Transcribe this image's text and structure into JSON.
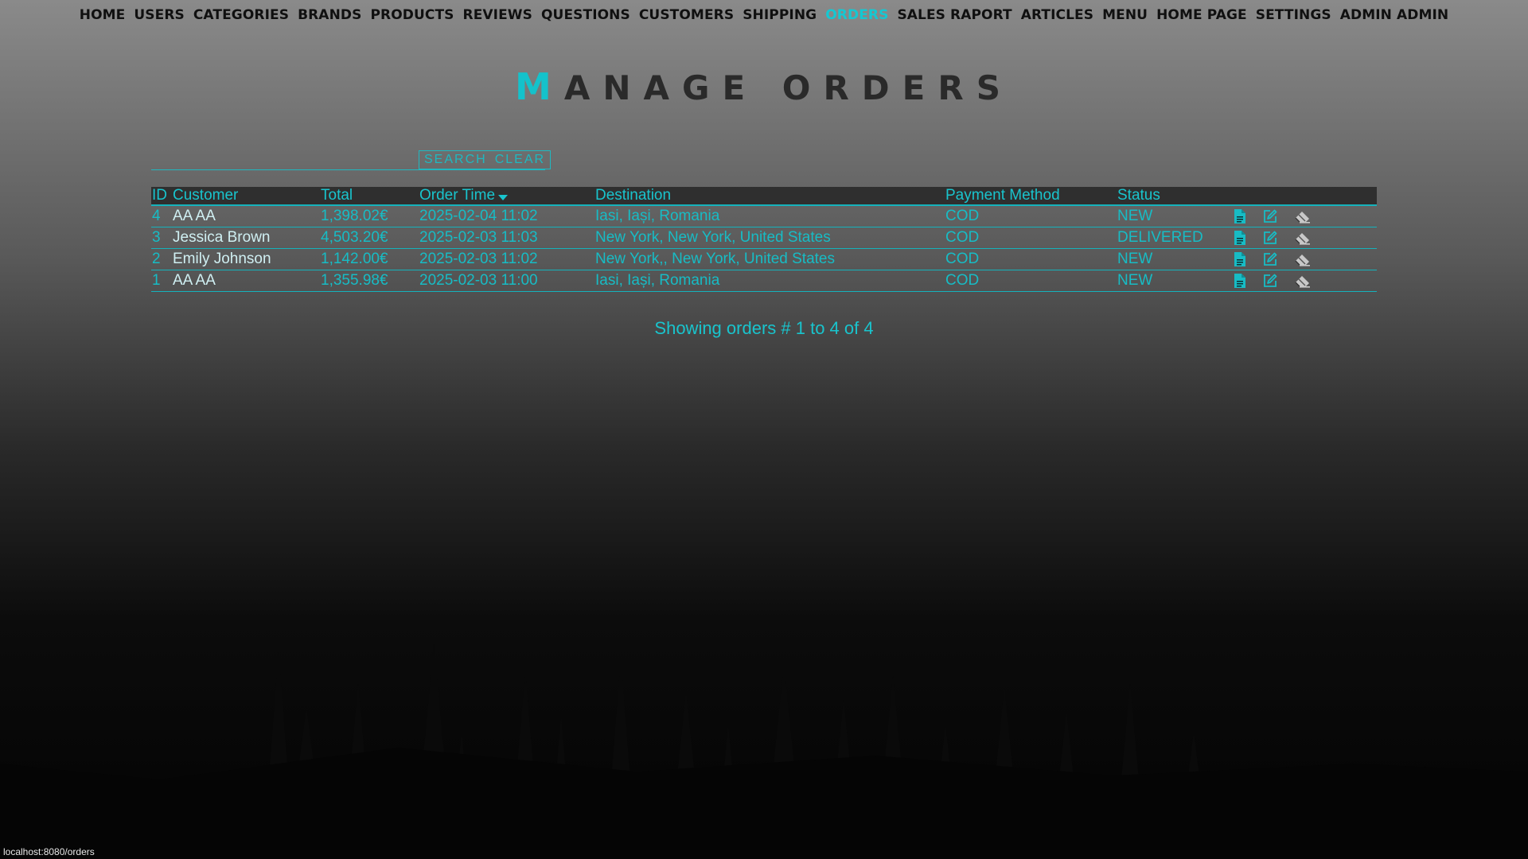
{
  "nav": {
    "items": [
      {
        "label": "HOME",
        "active": false
      },
      {
        "label": "USERS",
        "active": false
      },
      {
        "label": "CATEGORIES",
        "active": false
      },
      {
        "label": "BRANDS",
        "active": false
      },
      {
        "label": "PRODUCTS",
        "active": false
      },
      {
        "label": "REVIEWS",
        "active": false
      },
      {
        "label": "QUESTIONS",
        "active": false
      },
      {
        "label": "CUSTOMERS",
        "active": false
      },
      {
        "label": "SHIPPING",
        "active": false
      },
      {
        "label": "ORDERS",
        "active": true
      },
      {
        "label": "SALES RAPORT",
        "active": false
      },
      {
        "label": "ARTICLES",
        "active": false
      },
      {
        "label": "MENU",
        "active": false
      },
      {
        "label": "HOME PAGE",
        "active": false
      },
      {
        "label": "SETTINGS",
        "active": false
      },
      {
        "label": "ADMIN ADMIN",
        "active": false
      }
    ]
  },
  "page": {
    "title_first": "M",
    "title_rest": "anage orders"
  },
  "search": {
    "value": "",
    "search_label": "SEARCH",
    "clear_label": "CLEAR"
  },
  "table": {
    "headers": {
      "id": "ID",
      "customer": "Customer",
      "total": "Total",
      "order_time": "Order Time",
      "destination": "Destination",
      "payment": "Payment Method",
      "status": "Status"
    },
    "rows": [
      {
        "id": "4",
        "customer": "AA AA",
        "total": "1,398.02€",
        "order_time": "2025-02-04 11:02",
        "destination": "Iasi, Iași, Romania",
        "payment": "COD",
        "status": "NEW"
      },
      {
        "id": "3",
        "customer": "Jessica Brown",
        "total": "4,503.20€",
        "order_time": "2025-02-03 11:03",
        "destination": "New York, New York, United States",
        "payment": "COD",
        "status": "DELIVERED"
      },
      {
        "id": "2",
        "customer": "Emily Johnson",
        "total": "1,142.00€",
        "order_time": "2025-02-03 11:02",
        "destination": "New York,, New York, United States",
        "payment": "COD",
        "status": "NEW"
      },
      {
        "id": "1",
        "customer": "AA AA",
        "total": "1,355.98€",
        "order_time": "2025-02-03 11:00",
        "destination": "Iasi, Iași, Romania",
        "payment": "COD",
        "status": "NEW"
      }
    ],
    "row_icons": [
      "details-icon",
      "edit-icon",
      "delete-icon"
    ]
  },
  "summary": "Showing orders # 1 to 4 of 4",
  "status_bar": {
    "url": "localhost:8080/orders"
  },
  "colors": {
    "accent": "#14c2cb",
    "nav_text": "#101010",
    "header_bg": "#2f2f2f"
  }
}
